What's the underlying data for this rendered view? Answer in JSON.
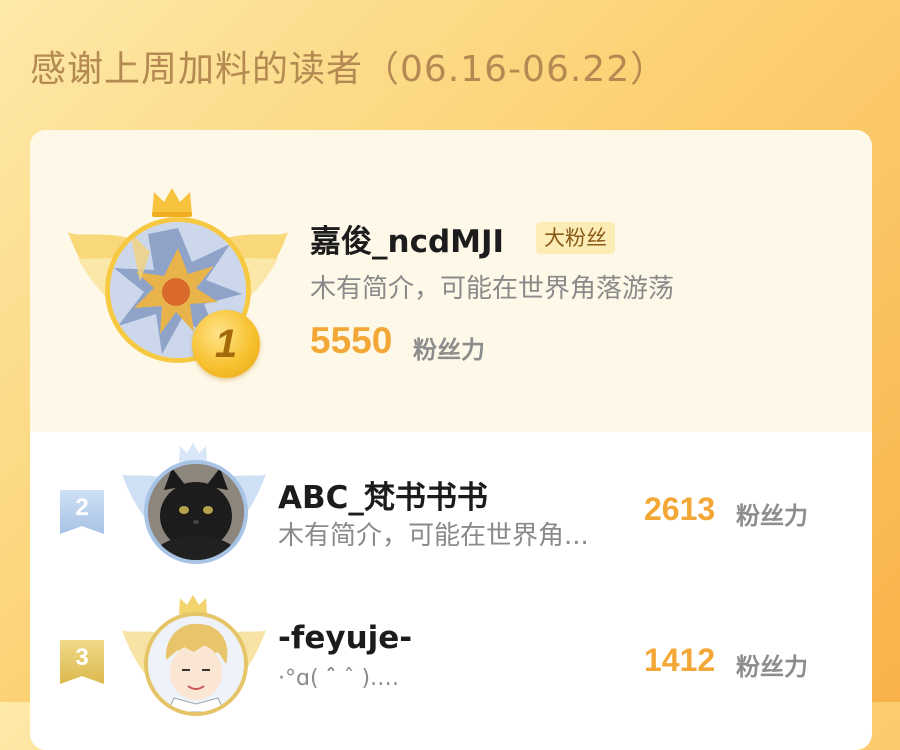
{
  "heading": "感谢上周加料的读者（06.16-06.22）",
  "colors": {
    "accent": "#f3a736",
    "gold": "#f7c943",
    "silver": "#a7c3e6",
    "bronze": "#e6c468",
    "tag_bg": "#fcecb5"
  },
  "top_reader": {
    "rank": "1",
    "name": "嘉俊_ncdMJI",
    "tag": "大粉丝",
    "bio": "木有简介，可能在世界角落游荡",
    "score": "5550",
    "unit": "粉丝力",
    "avatar_icon": "dragon-mecha-avatar",
    "crown_icon": "crown-icon"
  },
  "readers": [
    {
      "rank": "2",
      "name": "ABC_梵书书书",
      "bio": "木有简介，可能在世界角...",
      "score": "2613",
      "unit": "粉丝力",
      "avatar_icon": "black-cat-avatar"
    },
    {
      "rank": "3",
      "name": "-feyuje-",
      "bio": "·°ɑ( ˆ̑ ˆ ).…",
      "score": "1412",
      "unit": "粉丝力",
      "avatar_icon": "anime-boy-avatar"
    }
  ]
}
